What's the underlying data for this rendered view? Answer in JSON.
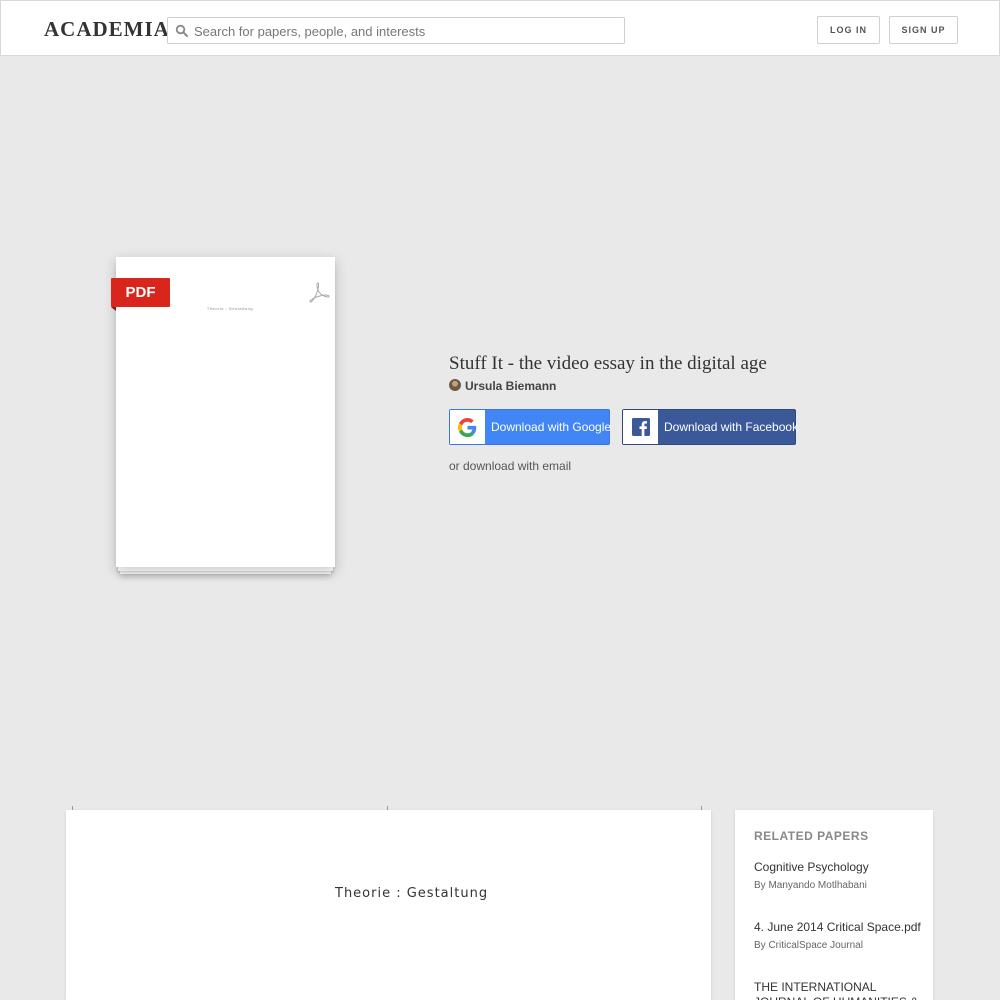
{
  "header": {
    "logo": "ACADEMIA",
    "search_placeholder": "Search for papers, people, and interests",
    "login_label": "LOG IN",
    "signup_label": "SIGN UP"
  },
  "thumbnail": {
    "badge": "PDF",
    "page_text": "Theorie : Gestaltung"
  },
  "paper": {
    "title": "Stuff It - the video essay in the digital age",
    "author": "Ursula Biemann"
  },
  "download": {
    "google_label": "Download with Google",
    "facebook_label": "Download with Facebook",
    "email_label": "or download with email"
  },
  "document": {
    "page_text": "Theorie : Gestaltung"
  },
  "related": {
    "heading": "RELATED PAPERS",
    "items": [
      {
        "title": "Cognitive Psychology",
        "by": "By Manyando Motlhabani"
      },
      {
        "title": "4. June 2014 Critical Space.pdf",
        "by": "By CriticalSpace Journal"
      },
      {
        "title": "THE INTERNATIONAL JOURNAL OF HUMANITIES & SOCIAL",
        "by": ""
      }
    ]
  },
  "colors": {
    "google_blue": "#4285f4",
    "facebook_blue": "#3b5998",
    "pdf_red": "#d9261c",
    "background": "#e9e9e9"
  }
}
